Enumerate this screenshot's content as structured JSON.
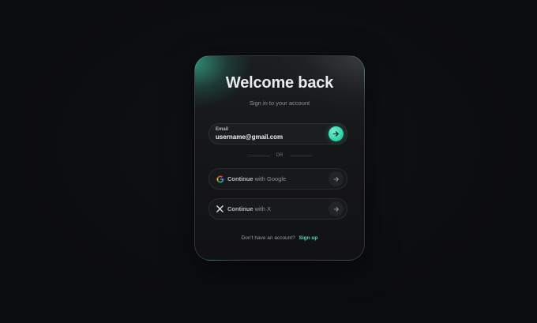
{
  "card": {
    "title": "Welcome back",
    "subtitle": "Sign in to your account"
  },
  "email": {
    "label": "Email",
    "value": "username@gmail.com",
    "submit_icon": "arrow-right-icon"
  },
  "divider": {
    "text": "OR"
  },
  "providers": [
    {
      "icon": "google-icon",
      "label_strong": "Continue",
      "label_rest": " with Google",
      "arrow_icon": "arrow-right-icon"
    },
    {
      "icon": "x-icon",
      "label_strong": "Continue",
      "label_rest": " with X",
      "arrow_icon": "arrow-right-icon"
    }
  ],
  "footer": {
    "prompt": "Don't have an account?",
    "link": "Sign up"
  },
  "colors": {
    "accent": "#3fd9b2",
    "background": "#0c0d10",
    "card": "#17181b"
  }
}
